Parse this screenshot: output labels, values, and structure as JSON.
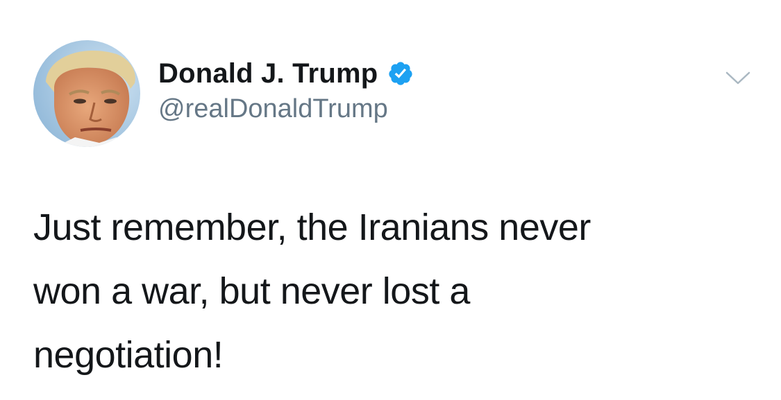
{
  "tweet": {
    "author": {
      "display_name": "Donald J. Trump",
      "handle": "@realDonaldTrump",
      "verified": true,
      "avatar_icon": "profile-photo",
      "verified_icon": "verified-badge-icon",
      "verified_color": "#1da1f2"
    },
    "menu_icon": "chevron-down-icon",
    "text_lines": [
      "Just remember, the Iranians never",
      "won a war, but never lost a",
      "negotiation!"
    ]
  }
}
